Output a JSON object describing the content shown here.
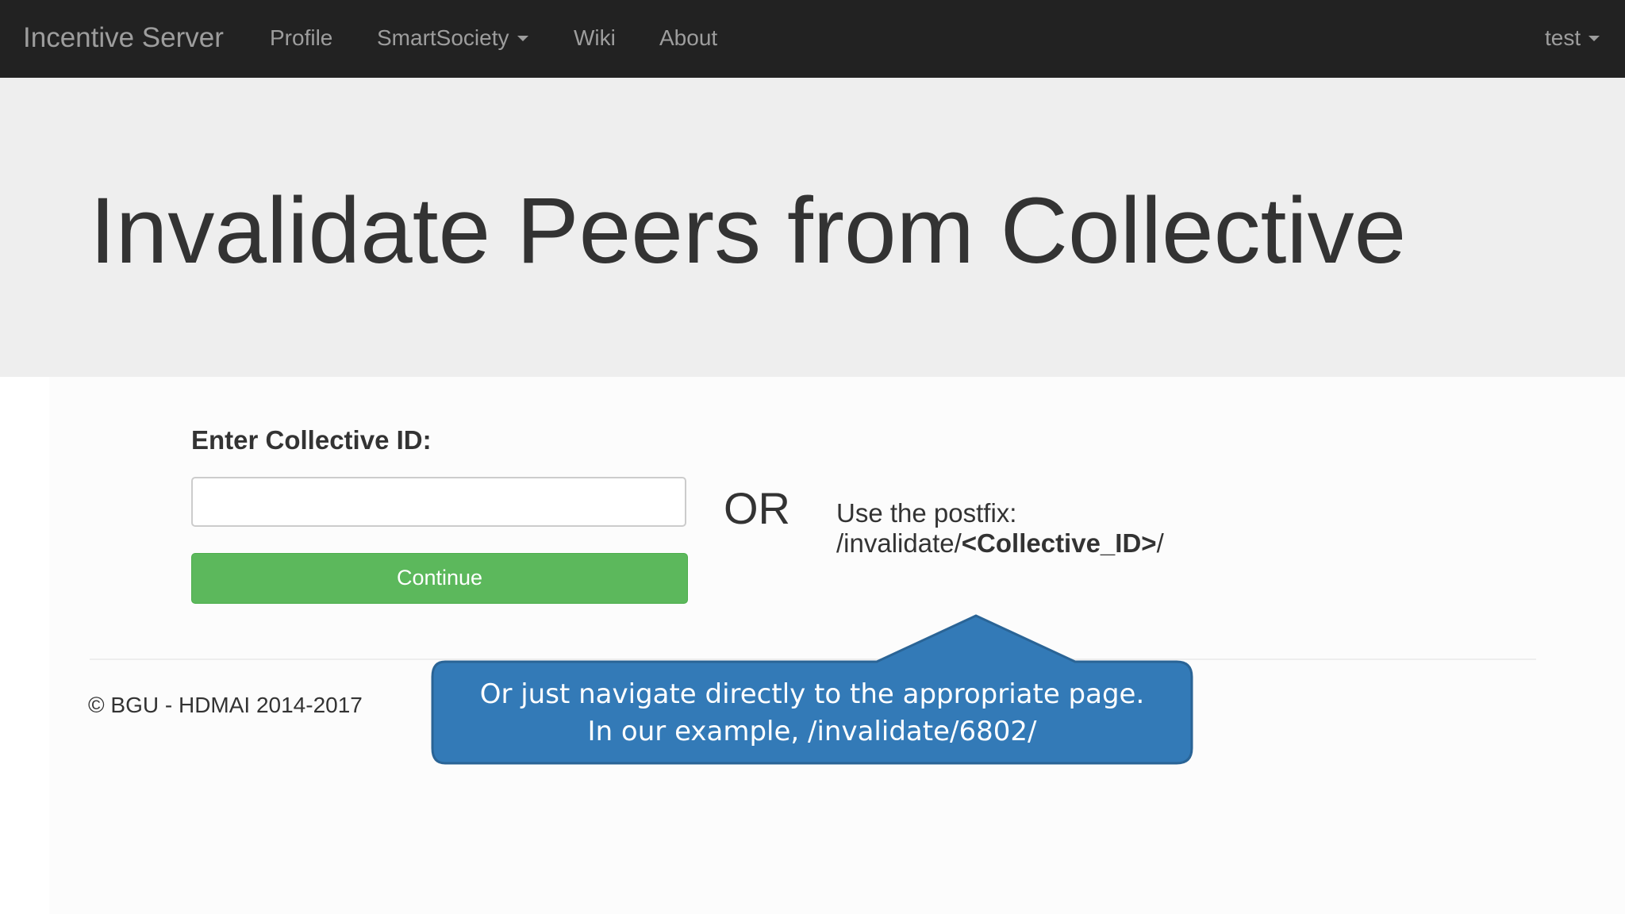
{
  "navbar": {
    "brand": "Incentive Server",
    "items": [
      {
        "label": "Profile"
      },
      {
        "label": "SmartSociety"
      },
      {
        "label": "Wiki"
      },
      {
        "label": "About"
      }
    ],
    "user_label": "test"
  },
  "jumbotron": {
    "title": "Invalidate Peers from Collective"
  },
  "form": {
    "label": "Enter Collective ID:",
    "input_value": "",
    "input_placeholder": "",
    "continue_label": "Continue"
  },
  "alternative": {
    "or_label": "OR",
    "postfix_intro": "Use the postfix:",
    "postfix_prefix": "/invalidate/",
    "postfix_param": "<Collective_ID>",
    "postfix_suffix": "/"
  },
  "footer": {
    "copyright": "© BGU - HDMAI 2014-2017"
  },
  "callout": {
    "line1": "Or just navigate directly to the appropriate page.",
    "line2": "In our example, /invalidate/6802/",
    "fill_color": "#337ab7",
    "border_color": "#2a6496"
  },
  "colors": {
    "navbar_bg": "#222222",
    "navbar_text": "#9d9d9d",
    "jumbotron_bg": "#eeeeee",
    "success_button": "#5cb85c"
  }
}
